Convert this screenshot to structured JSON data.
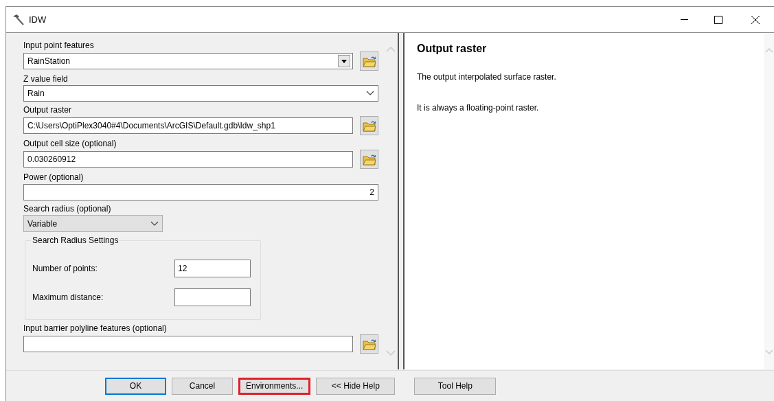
{
  "window": {
    "title": "IDW"
  },
  "parameters": [
    {
      "kind": "combo",
      "label": "Input point features",
      "value": "RainStation"
    },
    {
      "kind": "dropdown",
      "label": "Z value field",
      "value": "Rain"
    },
    {
      "kind": "browse",
      "label": "Output raster",
      "value": "C:\\Users\\OptiPlex3040#4\\Documents\\ArcGIS\\Default.gdb\\Idw_shp1"
    },
    {
      "kind": "browse",
      "label": "Output cell size (optional)",
      "value": "0.030260912"
    },
    {
      "kind": "number",
      "label": "Power (optional)",
      "value": "2"
    },
    {
      "kind": "select",
      "label": "Search radius (optional)",
      "value": "Variable"
    },
    {
      "kind": "group",
      "label": "Search Radius Settings",
      "fields": [
        {
          "label": "Number of points:",
          "value": "12"
        },
        {
          "label": "Maximum distance:"
        }
      ]
    },
    {
      "kind": "browse",
      "label": "Input barrier polyline features (optional)"
    }
  ],
  "help": {
    "title": "Output raster",
    "paragraphs": [
      "The output interpolated surface raster.",
      "It is always a floating-point raster."
    ]
  },
  "buttons": [
    {
      "label": "OK",
      "kind": "default"
    },
    {
      "label": "Cancel",
      "kind": "normal"
    },
    {
      "label": "Environments...",
      "kind": "highlighted"
    },
    {
      "label": "<< Hide Help",
      "kind": "normal"
    },
    {
      "label": "Tool Help",
      "kind": "separate"
    }
  ]
}
